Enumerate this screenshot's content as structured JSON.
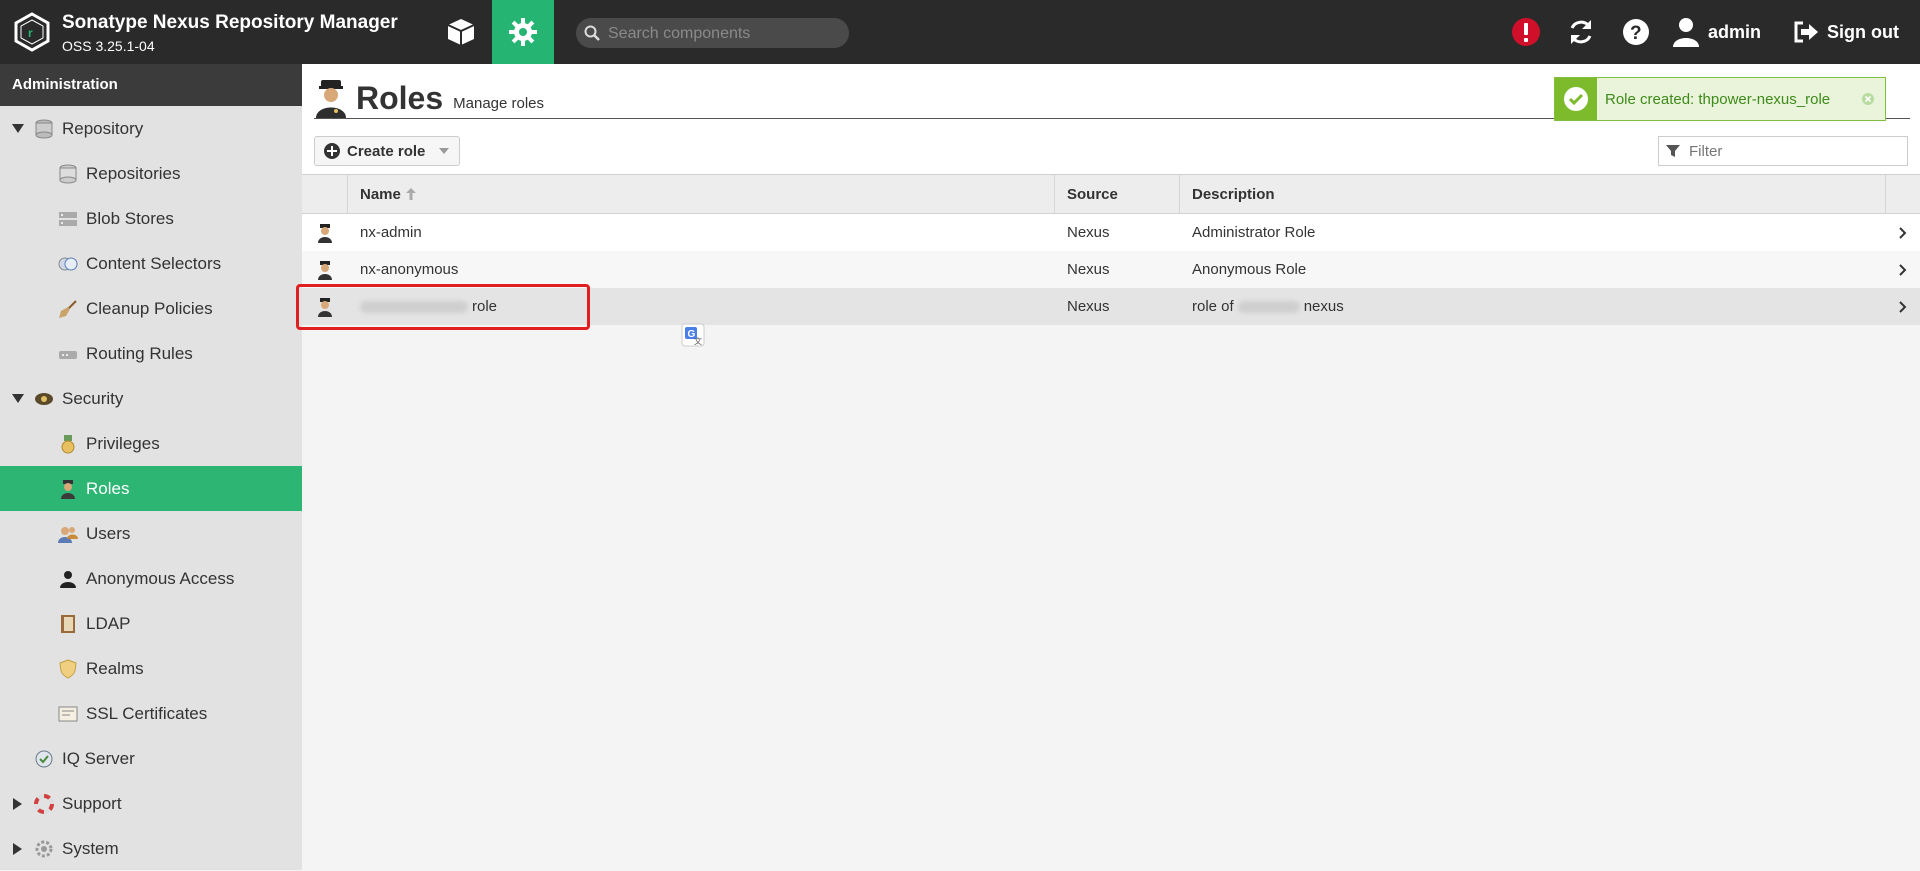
{
  "header": {
    "title": "Sonatype Nexus Repository Manager",
    "version": "OSS 3.25.1-04",
    "search_placeholder": "Search components",
    "user_label": "admin",
    "signout_label": "Sign out"
  },
  "sidebar": {
    "header": "Administration",
    "items": [
      {
        "label": "Repository",
        "icon": "database-icon",
        "level": 0,
        "expanded": true
      },
      {
        "label": "Repositories",
        "icon": "database-icon",
        "level": 1
      },
      {
        "label": "Blob Stores",
        "icon": "server-icon",
        "level": 1
      },
      {
        "label": "Content Selectors",
        "icon": "selector-icon",
        "level": 1
      },
      {
        "label": "Cleanup Policies",
        "icon": "broom-icon",
        "level": 1
      },
      {
        "label": "Routing Rules",
        "icon": "router-icon",
        "level": 1
      },
      {
        "label": "Security",
        "icon": "badge-icon",
        "level": 0,
        "expanded": true
      },
      {
        "label": "Privileges",
        "icon": "medal-icon",
        "level": 1
      },
      {
        "label": "Roles",
        "icon": "officer-icon",
        "level": 1,
        "active": true
      },
      {
        "label": "Users",
        "icon": "users-icon",
        "level": 1
      },
      {
        "label": "Anonymous Access",
        "icon": "person-icon",
        "level": 1
      },
      {
        "label": "LDAP",
        "icon": "book-icon",
        "level": 1
      },
      {
        "label": "Realms",
        "icon": "shield-icon",
        "level": 1
      },
      {
        "label": "SSL Certificates",
        "icon": "certificate-icon",
        "level": 1
      },
      {
        "label": "IQ Server",
        "icon": "iq-icon",
        "level": 0
      },
      {
        "label": "Support",
        "icon": "lifebuoy-icon",
        "level": 0,
        "expanded": false
      },
      {
        "label": "System",
        "icon": "gear-icon",
        "level": 0,
        "expanded": false
      }
    ]
  },
  "page": {
    "title": "Roles",
    "subtitle": "Manage roles",
    "create_button": "Create role",
    "filter_placeholder": "Filter"
  },
  "toast": {
    "message": "Role created: thpower-nexus_role"
  },
  "table": {
    "columns": [
      "Name",
      "Source",
      "Description"
    ],
    "rows": [
      {
        "name": "nx-admin",
        "source": "Nexus",
        "description": "Administrator Role"
      },
      {
        "name": "nx-anonymous",
        "source": "Nexus",
        "description": "Anonymous Role"
      },
      {
        "name": "role",
        "source": "Nexus",
        "description_prefix": "role of",
        "description_suffix": "nexus"
      }
    ]
  },
  "colors": {
    "accent": "#25b472",
    "header_bg": "#2a2a2a",
    "alert": "#d0102b",
    "highlight": "#e02020"
  }
}
